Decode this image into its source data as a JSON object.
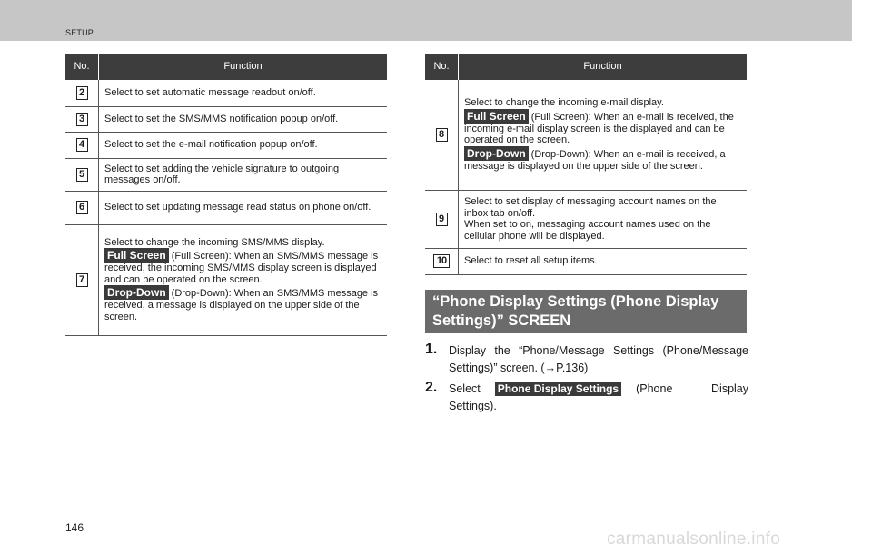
{
  "header": {
    "section": "SETUP"
  },
  "table_headers": {
    "no": "No.",
    "function": "Function"
  },
  "left_rows": [
    {
      "num": "2",
      "text": "Select to set automatic message readout on/off."
    },
    {
      "num": "3",
      "text": "Select to set the SMS/MMS notification popup on/off."
    },
    {
      "num": "4",
      "text": "Select to set the e-mail notification popup on/off."
    },
    {
      "num": "5",
      "text": "Select to set adding the vehicle signature to outgoing messages on/off."
    },
    {
      "num": "6",
      "text": "Select to set updating message read status on phone on/off."
    },
    {
      "num": "7",
      "intro": "Select to change the incoming SMS/MMS display.",
      "full_tag": "Full Screen",
      "full_text": "(Full Screen): When an SMS/MMS message is received, the incoming SMS/MMS display screen is displayed and can be operated on the screen.",
      "drop_tag": "Drop-Down",
      "drop_text": "(Drop-Down): When an SMS/MMS message is received, a message is displayed on the upper side of the screen."
    }
  ],
  "right_rows": [
    {
      "num": "8",
      "intro": "Select to change the incoming e-mail display.",
      "full_tag": "Full Screen",
      "full_text": "(Full Screen): When an e-mail is received, the incoming e-mail display screen is the displayed and can be operated on the screen.",
      "drop_tag": "Drop-Down",
      "drop_text": "(Drop-Down): When an e-mail is received, a message is displayed on the upper side of the screen."
    },
    {
      "num": "9",
      "text": "Select to set display of messaging account names on the inbox tab on/off.",
      "text2": "When set to on, messaging account names used on the cellular phone will be displayed."
    },
    {
      "num": "10",
      "text": "Select to reset all setup items."
    }
  ],
  "section_heading": "“Phone Display Settings (Phone Display Settings)” SCREEN",
  "steps": [
    {
      "num": "1.",
      "text": "Display the “Phone/Message Settings (Phone/Message Settings)” screen. (→P.136)"
    },
    {
      "num": "2.",
      "before": "Select",
      "tag": "Phone Display Settings",
      "after": "(Phone Display Settings)."
    }
  ],
  "page_number": "146",
  "watermark": "carmanualsonline.info"
}
